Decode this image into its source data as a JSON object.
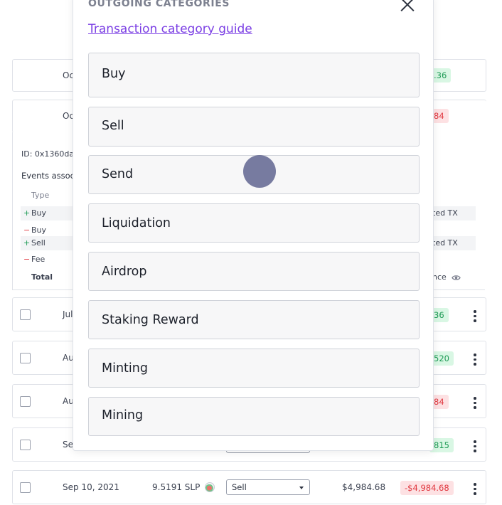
{
  "modal": {
    "title": "OUTGOING CATEGORIES",
    "guide_link": "Transaction category guide",
    "categories": [
      "Buy",
      "Sell",
      "Send",
      "Liquidation",
      "Airdrop",
      "Staking Reward",
      "Minting",
      "Mining"
    ]
  },
  "table": {
    "top_rows": [
      {
        "date": "Oct",
        "amount": ".36",
        "sign": "pos"
      },
      {
        "date": "Oct",
        "amount": "84",
        "sign": "neg"
      }
    ],
    "detail": {
      "id_label": "ID: 0x1360da5",
      "events_label": "Events assoc",
      "type_header": "Type",
      "events": [
        {
          "sign": "+",
          "type": "Buy",
          "link": "ted TX"
        },
        {
          "sign": "−",
          "type": "Buy",
          "link": ""
        },
        {
          "sign": "+",
          "type": "Sell",
          "link": "ted TX"
        },
        {
          "sign": "−",
          "type": "Fee",
          "link": ""
        }
      ],
      "total_label": "Total",
      "balance_link": "nce"
    },
    "rows": [
      {
        "date": "Jul",
        "amount": "36",
        "sign": "pos"
      },
      {
        "date": "Au",
        "amount": "520",
        "sign": "pos"
      },
      {
        "date": "Au",
        "amount": "84",
        "sign": "neg"
      },
      {
        "date": "Se",
        "amount": "815",
        "sign": "pos"
      },
      {
        "date": "Sep 10, 2021",
        "quantity": "9.5191 SLP",
        "category": "Sell",
        "price": "$4,984.68",
        "amount": "-$4,984.68",
        "sign": "neg"
      }
    ]
  },
  "colors": {
    "accent": "#7b3fe4",
    "positive": "#1e9b55",
    "negative": "#e0373f"
  },
  "icons": {
    "close": "close-icon",
    "eye": "eye-icon",
    "token": "slp-token-icon",
    "menu": "more-vertical-icon"
  }
}
